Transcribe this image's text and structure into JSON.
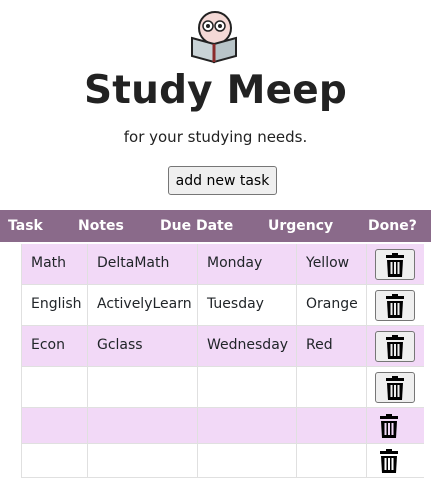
{
  "header": {
    "title": "Study Meep",
    "subtitle": "for your studying needs.",
    "add_button_label": "add new task"
  },
  "table": {
    "columns": [
      "Task",
      "Notes",
      "Due Date",
      "Urgency",
      "Done?"
    ],
    "rows": [
      {
        "task": "Math",
        "notes": "DeltaMath",
        "due": "Monday",
        "urgency": "Yellow"
      },
      {
        "task": "English",
        "notes": "ActivelyLearn",
        "due": "Tuesday",
        "urgency": "Orange"
      },
      {
        "task": "Econ",
        "notes": "Gclass",
        "due": "Wednesday",
        "urgency": "Red"
      },
      {
        "task": "",
        "notes": "",
        "due": "",
        "urgency": ""
      },
      {
        "task": "",
        "notes": "",
        "due": "",
        "urgency": ""
      },
      {
        "task": "",
        "notes": "",
        "due": "",
        "urgency": ""
      }
    ]
  },
  "icons": {
    "logo": "meep-reading-book-icon",
    "delete": "trash-icon"
  },
  "colors": {
    "header_bar": "#8a6a8a",
    "row_pink": "#f2d9f7",
    "row_white": "#ffffff"
  }
}
